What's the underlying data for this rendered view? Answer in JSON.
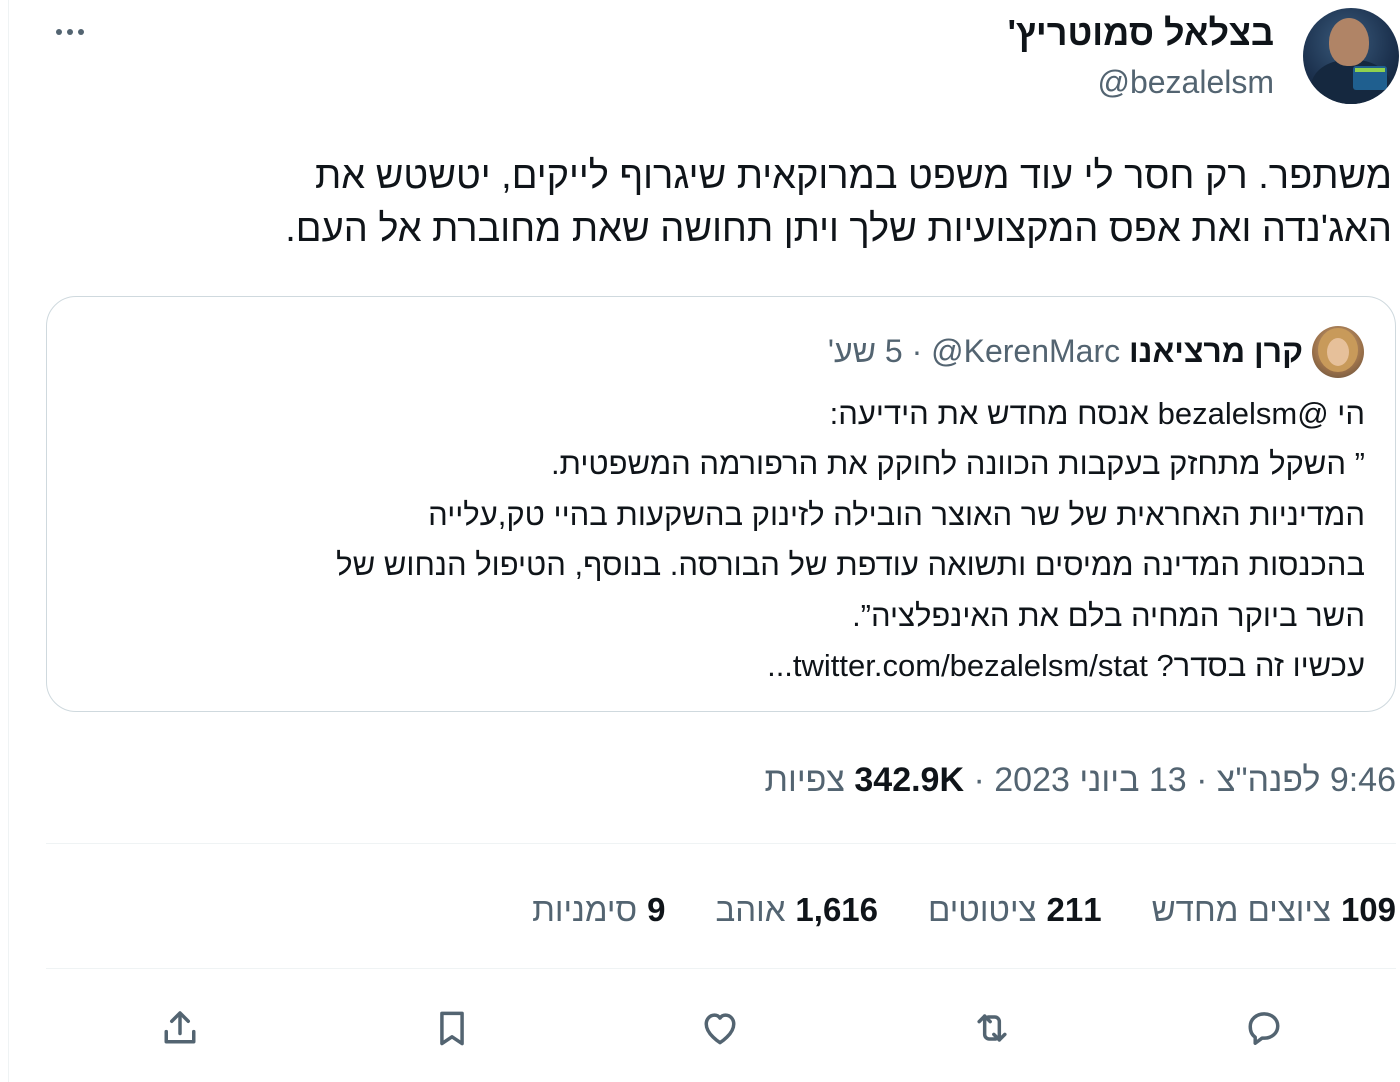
{
  "author": {
    "name": "בצלאל סמוטריץ'",
    "handle": "@bezalelsm"
  },
  "tweet": {
    "text": "משתפר. רק חסר לי עוד משפט במרוקאית שיגרוף לייקים, יטשטש את\nהאג'נדה ואת אפס המקצועיות שלך ויתן תחושה שאת מחוברת אל העם."
  },
  "quote": {
    "name": "קרן מרציאנו",
    "handle": "@KerenMarc",
    "separator": "·",
    "time": "5 שע'",
    "text": "הי @bezalelsm אנסח מחדש את הידיעה:\n” השקל מתחזק בעקבות הכוונה לחוקק את הרפורמה המשפטית.\nהמדיניות האחראית של שר האוצר הובילה לזינוק בהשקעות בהיי טק,עלייה\nבהכנסות המדינה ממיסים ותשואה עודפת של הבורסה. בנוסף, הטיפול הנחוש של\nהשר ביוקר המחיה בלם את האינפלציה”.",
    "last_line_prefix": "עכשיו זה בסדר? ",
    "link": "twitter.com/bezalelsm/stat..."
  },
  "meta": {
    "time": "9:46 לפנה\"צ",
    "separator1": "·",
    "date": "13 ביוני 2023",
    "separator2": "·",
    "views_count": "342.9K",
    "views_label": "צפיות"
  },
  "stats": {
    "retweets": {
      "count": "109",
      "label": "ציוצים מחדש"
    },
    "quotes": {
      "count": "211",
      "label": "ציטוטים"
    },
    "likes": {
      "count": "1,616",
      "label": "אוהב"
    },
    "bookmarks": {
      "count": "9",
      "label": "סימניות"
    }
  },
  "icons": {
    "more": "more-icon",
    "reply": "reply-icon",
    "retweet": "retweet-icon",
    "like": "like-icon",
    "bookmark": "bookmark-icon",
    "share": "share-icon"
  }
}
